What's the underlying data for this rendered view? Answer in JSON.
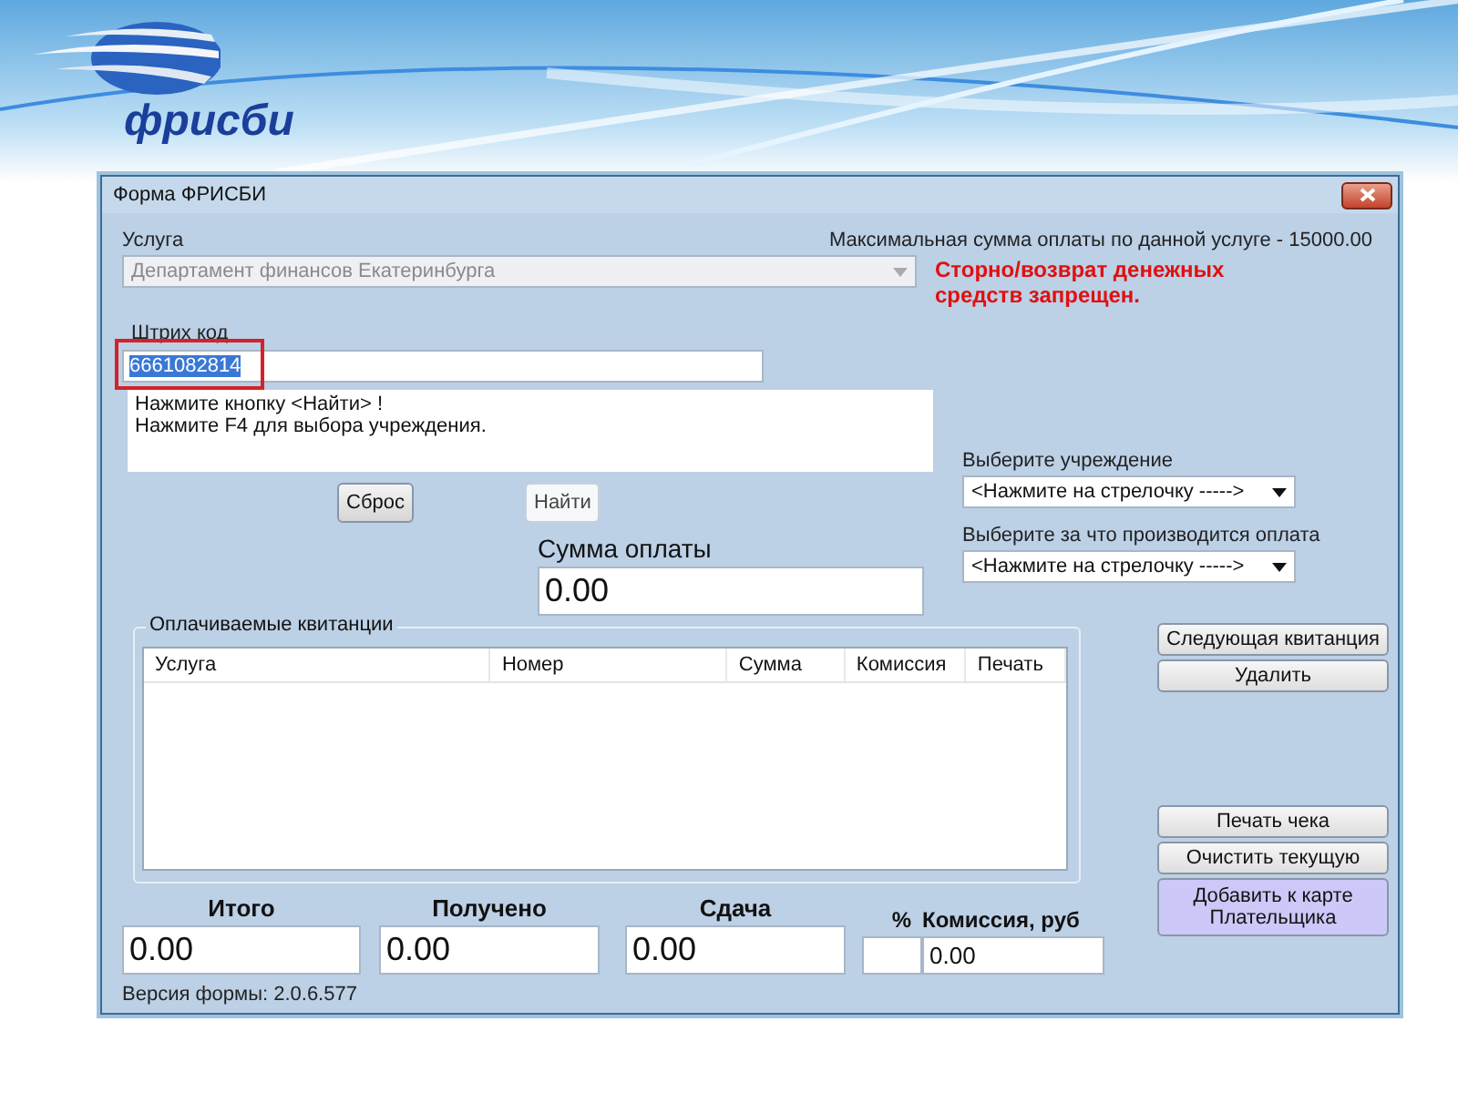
{
  "slide": {
    "logo_text": "фрисби"
  },
  "window": {
    "title": "Форма ФРИСБИ"
  },
  "service": {
    "label": "Услуга",
    "value": "Департамент финансов Екатеринбурга",
    "disabled": true
  },
  "max_sum_note": "Максимальная сумма оплаты по данной услуге - 15000.00",
  "warning": "Сторно/возврат денежных средств запрещен.",
  "barcode": {
    "label": "Штрих код",
    "value": "6661082814",
    "value_selected": true,
    "highlighted": true
  },
  "messages": [
    "Нажмите кнопку <Найти> !",
    "Нажмите F4 для выбора учреждения."
  ],
  "search_buttons": [
    {
      "label": "Сброс",
      "kind": "raised"
    },
    {
      "label": "Найти",
      "kind": "flat"
    }
  ],
  "institution": {
    "label": "Выберите учреждение",
    "value": "<Нажмите на стрелочку ----->"
  },
  "payment_for": {
    "label": "Выберите за что производится оплата",
    "value": "<Нажмите на стрелочку ----->"
  },
  "sum": {
    "label": "Сумма оплаты",
    "value": "0.00"
  },
  "receipts": {
    "title": "Оплачиваемые квитанции",
    "columns": [
      "Услуга",
      "Номер",
      "Сумма",
      "Комиссия",
      "Печать"
    ]
  },
  "list_buttons": [
    {
      "label": "Следующая квитанция",
      "kind": "normal"
    },
    {
      "label": "Удалить",
      "kind": "normal"
    }
  ],
  "action_buttons": [
    {
      "label": "Печать чека",
      "kind": "normal"
    },
    {
      "label": "Очистить текущую",
      "kind": "normal"
    },
    {
      "label": "Добавить к карте Плательщика",
      "kind": "accent"
    }
  ],
  "totals": [
    {
      "label": "Итого",
      "value": "0.00"
    },
    {
      "label": "Получено",
      "value": "0.00"
    },
    {
      "label": "Сдача",
      "value": "0.00"
    }
  ],
  "commission": {
    "percent_label": "%",
    "label": "Комиссия, руб",
    "value": "0.00"
  },
  "version": "Версия формы: 2.0.6.577"
}
